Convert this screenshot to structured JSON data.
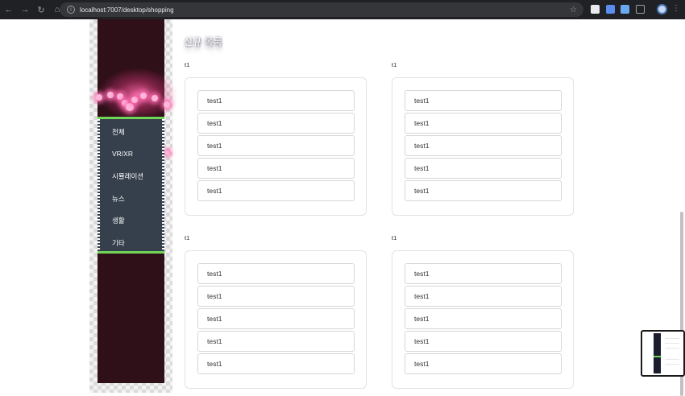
{
  "browser": {
    "url": "localhost:7007/desktop/shopping"
  },
  "sidebar": {
    "items": [
      {
        "label": "전체"
      },
      {
        "label": "VR/XR"
      },
      {
        "label": "시뮬레이션"
      },
      {
        "label": "뉴스"
      },
      {
        "label": "생활"
      },
      {
        "label": "기타"
      }
    ]
  },
  "main": {
    "section_title": "신규 목록",
    "groups": [
      {
        "label": "t1",
        "items": [
          "test1",
          "test1",
          "test1",
          "test1",
          "test1"
        ]
      },
      {
        "label": "t1",
        "items": [
          "test1",
          "test1",
          "test1",
          "test1",
          "test1"
        ]
      },
      {
        "label": "t1",
        "items": [
          "test1",
          "test1",
          "test1",
          "test1",
          "test1"
        ]
      },
      {
        "label": "t1",
        "items": [
          "test1",
          "test1",
          "test1",
          "test1",
          "test1"
        ]
      }
    ]
  },
  "colors": {
    "sidebar_dark": "#2f0f18",
    "menu_bg": "#36404d",
    "menu_accent": "#71d557",
    "glow": "#ff6eaa"
  },
  "icons": [
    "back-arrow-icon",
    "forward-arrow-icon",
    "reload-icon",
    "home-icon",
    "site-info-icon",
    "bookmark-star-icon",
    "extension-icon",
    "profile-avatar-icon",
    "more-menu-icon"
  ]
}
